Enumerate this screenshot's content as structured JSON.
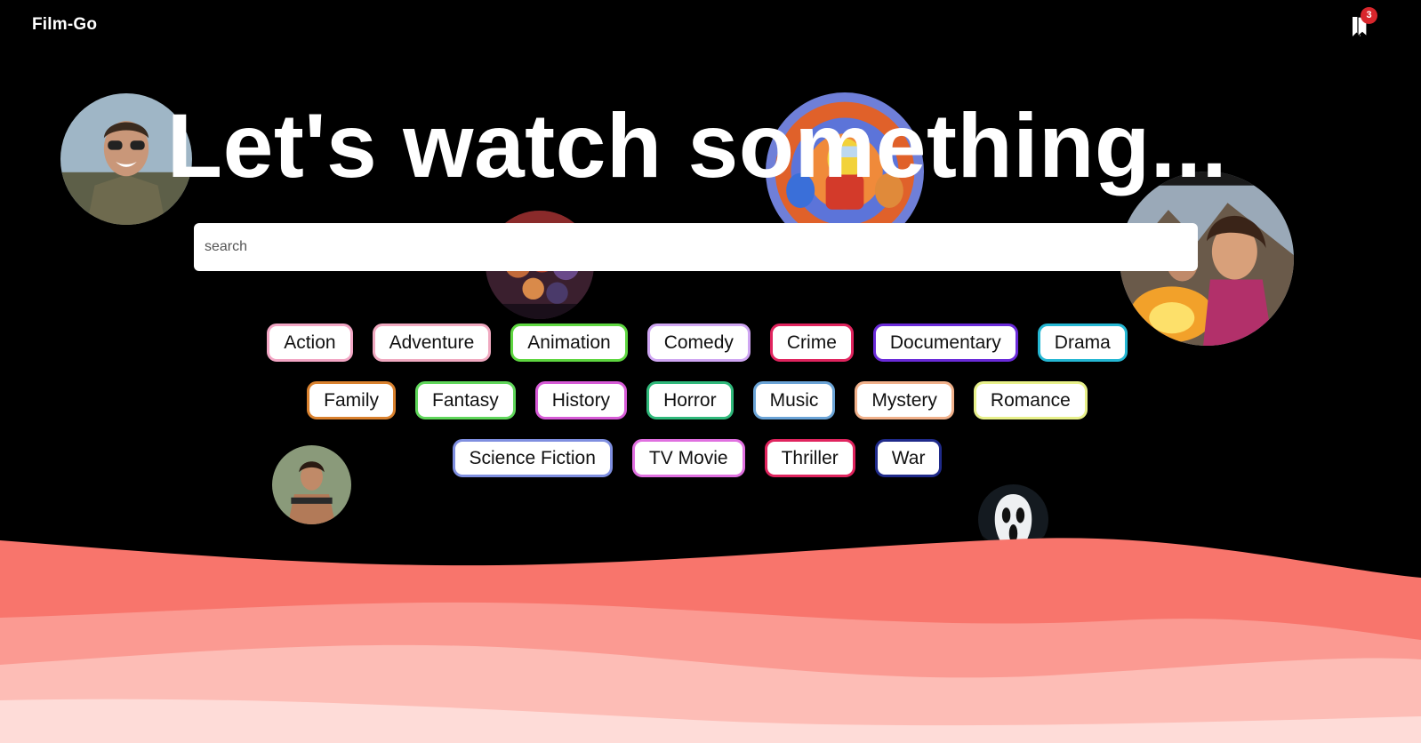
{
  "brand": "Film-Go",
  "bookmarks": {
    "count": "3",
    "icon": "bookmark-icon"
  },
  "hero": {
    "title": "Let's watch something..."
  },
  "search": {
    "placeholder": "search",
    "value": ""
  },
  "genre_rows": [
    [
      {
        "label": "Action",
        "color": "#f2a6c4"
      },
      {
        "label": "Adventure",
        "color": "#f0a9c0"
      },
      {
        "label": "Animation",
        "color": "#5ed640"
      },
      {
        "label": "Comedy",
        "color": "#cfa6f2"
      },
      {
        "label": "Crime",
        "color": "#e0245e"
      },
      {
        "label": "Documentary",
        "color": "#6a2bd9"
      },
      {
        "label": "Drama",
        "color": "#25b7d3"
      }
    ],
    [
      {
        "label": "Family",
        "color": "#d9812e"
      },
      {
        "label": "Fantasy",
        "color": "#5fd65a"
      },
      {
        "label": "History",
        "color": "#d65ad6"
      },
      {
        "label": "Horror",
        "color": "#2fb87a"
      },
      {
        "label": "Music",
        "color": "#6aa3d6"
      },
      {
        "label": "Mystery",
        "color": "#f0b08a"
      },
      {
        "label": "Romance",
        "color": "#e7f08a"
      }
    ],
    [
      {
        "label": "Science Fiction",
        "color": "#7f8fe0"
      },
      {
        "label": "TV Movie",
        "color": "#e070e0"
      },
      {
        "label": "Thriller",
        "color": "#e0245e"
      },
      {
        "label": "War",
        "color": "#1f2a8a"
      }
    ]
  ],
  "colors": {
    "background": "#000000",
    "wave_1": "#f8756c",
    "wave_2": "#fb9a92",
    "wave_3": "#fdbdb6",
    "wave_4": "#fedcd8",
    "badge": "#d8262c"
  }
}
